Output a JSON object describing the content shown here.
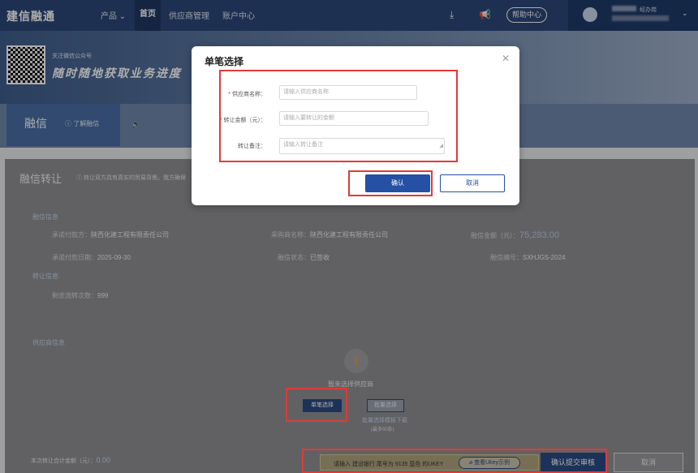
{
  "header": {
    "logo": "建信融通",
    "nav": [
      "产品",
      "首页",
      "供应商管理",
      "账户中心"
    ],
    "help": "帮助中心",
    "user_role": "经办岗"
  },
  "banner": {
    "small": "关注微信公众号",
    "big": "随时随地获取业务进度"
  },
  "tab": {
    "title": "融信",
    "link": "了解融信"
  },
  "page": {
    "title": "融信转让",
    "tip": "转让双方具有真实的贸易背景。我方确保"
  },
  "finance_info": {
    "heading": "融信信息",
    "payer_label": "承诺付款方：",
    "payer": "陕西化建工程有限责任公司",
    "buyer_label": "采购商名称：",
    "buyer": "陕西化建工程有限责任公司",
    "amount_label": "融信金额（元）：",
    "amount": "75,283.00",
    "date_label": "承诺付款日期：",
    "date": "2025-09-30",
    "status_label": "融信状态：",
    "status": "已签收",
    "code_label": "融信编号：",
    "code": "SXHJGS-2024"
  },
  "transfer_info": {
    "heading": "转让信息",
    "remain_label": "剩余流转次数：",
    "remain": "999"
  },
  "supplier_info": {
    "heading": "供应商信息",
    "empty": "暂未选择供应商",
    "single_btn": "单笔选择",
    "batch_btn": "批量选择",
    "batch_link": "批量选择模板下载",
    "batch_limit": "(最多50条)"
  },
  "footer": {
    "total_label": "本次转让合计金额（元）：",
    "total": "0.00",
    "ukey_text": "请插入 建设银行 尾号为 9135 蓝色 的UKEY",
    "ukey_btn": "查看Ukey示例",
    "submit": "确认提交审核",
    "cancel": "取消"
  },
  "modal": {
    "title": "单笔选择",
    "supplier_label": "供应商名称：",
    "supplier_placeholder": "请输入供应商名称",
    "amount_label": "转让金额（元）：",
    "amount_placeholder": "请输入要转让的金额",
    "remark_label": "转让备注：",
    "remark_placeholder": "请输入转让备注",
    "ok": "确认",
    "cancel": "取消"
  },
  "colors": {
    "primary": "#2550a4",
    "nav": "#2b4878",
    "highlight": "#e23a36"
  }
}
